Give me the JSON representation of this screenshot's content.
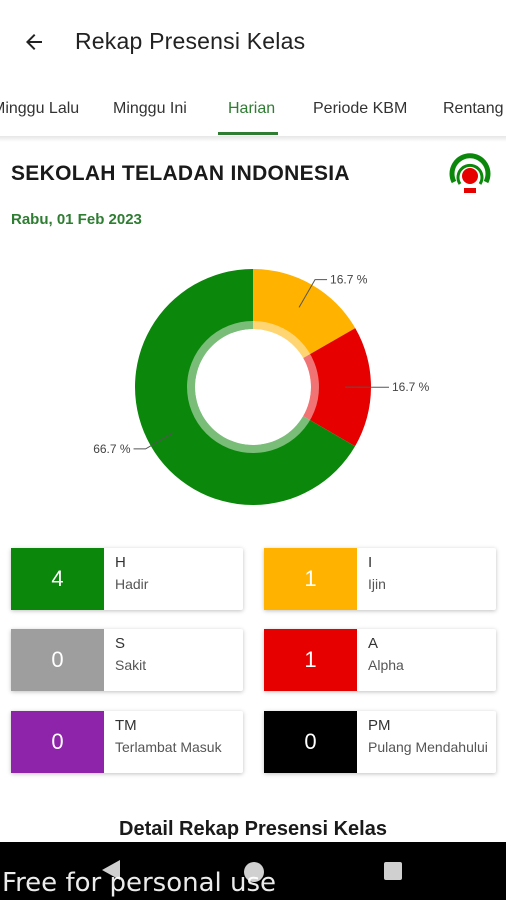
{
  "app_bar": {
    "title": "Rekap Presensi Kelas"
  },
  "tabs": [
    {
      "label": "Minggu Lalu"
    },
    {
      "label": "Minggu Ini"
    },
    {
      "label": "Harian",
      "active": true
    },
    {
      "label": "Periode KBM"
    },
    {
      "label": "Rentang"
    }
  ],
  "header": {
    "school_name": "SEKOLAH TELADAN INDONESIA",
    "date": "Rabu, 01 Feb 2023"
  },
  "chart_data": {
    "type": "pie",
    "categories": [
      "Ijin",
      "Alpha",
      "Hadir"
    ],
    "values": [
      16.7,
      16.7,
      66.7
    ],
    "labels": [
      "16.7 %",
      "16.7 %",
      "66.7 %"
    ],
    "colors": [
      "#ffb300",
      "#e60000",
      "#0b870b"
    ]
  },
  "stats": [
    {
      "count": "4",
      "code": "H",
      "label": "Hadir",
      "color": "#0b870b"
    },
    {
      "count": "1",
      "code": "I",
      "label": "Ijin",
      "color": "#ffb300"
    },
    {
      "count": "0",
      "code": "S",
      "label": "Sakit",
      "color": "#9e9e9e"
    },
    {
      "count": "1",
      "code": "A",
      "label": "Alpha",
      "color": "#e60000"
    },
    {
      "count": "0",
      "code": "TM",
      "label": "Terlambat Masuk",
      "color": "#8e24aa"
    },
    {
      "count": "0",
      "code": "PM",
      "label": "Pulang Mendahului",
      "color": "#000000"
    }
  ],
  "detail": {
    "title": "Detail Rekap Presensi Kelas"
  },
  "watermark": "Free for personal use",
  "theme": {
    "accent": "#2e7d32"
  }
}
